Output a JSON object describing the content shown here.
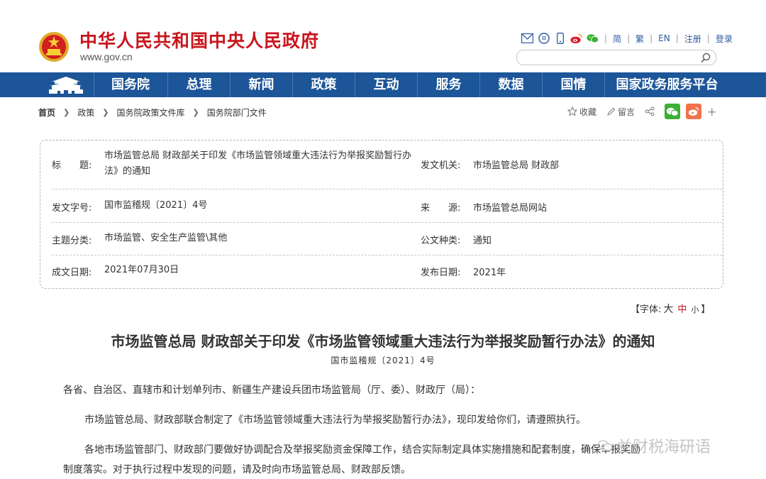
{
  "header": {
    "site_title": "中华人民共和国中央人民政府",
    "site_url": "www.gov.cn",
    "lang_links": [
      "简",
      "繁",
      "EN",
      "注册",
      "登录"
    ],
    "search_placeholder": ""
  },
  "nav": {
    "items": [
      "国务院",
      "总理",
      "新闻",
      "政策",
      "互动",
      "服务",
      "数据",
      "国情",
      "国家政务服务平台"
    ]
  },
  "breadcrumb": [
    "首页",
    "政策",
    "国务院政策文件库",
    "国务院部门文件"
  ],
  "actions": {
    "favorite": "收藏",
    "comment": "留言",
    "more": "+"
  },
  "info": {
    "title_label": "标　　题:",
    "title_value": "市场监管总局 财政部关于印发《市场监管领域重大违法行为举报奖励暂行办法》的通知",
    "issuer_label": "发文机关:",
    "issuer_value": "市场监管总局 财政部",
    "docno_label": "发文字号:",
    "docno_value": "国市监稽规〔2021〕4号",
    "source_label": "来　　源:",
    "source_value": "市场监管总局网站",
    "topic_label": "主题分类:",
    "topic_value": "市场监管、安全生产监管\\其他",
    "type_label": "公文种类:",
    "type_value": "通知",
    "date_label": "成文日期:",
    "date_value": "2021年07月30日",
    "pub_label": "发布日期:",
    "pub_value": "2021年"
  },
  "fontsize": {
    "prefix": "【字体:",
    "big": "大",
    "mid": "中",
    "small": "小",
    "suffix": "】"
  },
  "doc": {
    "title": "市场监管总局 财政部关于印发《市场监管领域重大违法行为举报奖励暂行办法》的通知",
    "number": "国市监稽规〔2021〕4号",
    "p1": "各省、自治区、直辖市和计划单列市、新疆生产建设兵团市场监管局（厅、委）、财政厅（局）：",
    "p2": "市场监管总局、财政部联合制定了《市场监管领域重大违法行为举报奖励暂行办法》，现印发给你们，请遵照执行。",
    "p3": "各地市场监管部门、财政部门要做好协调配合及举报奖励资金保障工作，结合实际制定具体实施措施和配套制度，确保举报奖励",
    "p4": "制度落实。对于执行过程中发现的问题，请及时向市场监管总局、财政部反馈。"
  },
  "watermark": "兰财税海研语",
  "colors": {
    "brand_red": "#c8161d",
    "nav_blue": "#1c5598",
    "link_blue": "#2c5aa0",
    "wechat_green": "#3cb034",
    "weibo_orange": "#f0734b"
  }
}
